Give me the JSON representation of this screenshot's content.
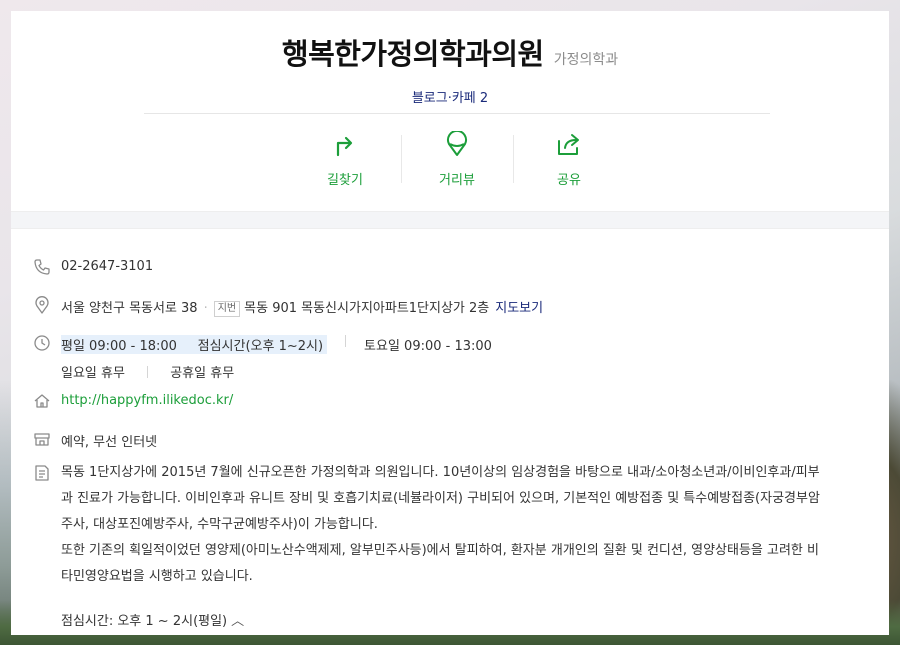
{
  "header": {
    "title": "행복한가정의학과의원",
    "category": "가정의학과",
    "blog_cafe": "블로그·카페 2"
  },
  "actions": [
    {
      "label": "길찾기",
      "icon": "directions-icon"
    },
    {
      "label": "거리뷰",
      "icon": "street-view-icon"
    },
    {
      "label": "공유",
      "icon": "share-icon"
    }
  ],
  "info": {
    "phone": "02-2647-3101",
    "address": {
      "road": "서울 양천구 목동서로 38",
      "lot_badge": "지번",
      "lot": "목동 901 목동신시가지아파트1단지상가 2층",
      "map_link": "지도보기"
    },
    "hours": {
      "weekday": "평일 09:00 - 18:00",
      "lunch": "점심시간(오후 1~2시)",
      "saturday": "토요일 09:00 - 13:00",
      "sunday": "일요일 휴무",
      "holiday": "공휴일 휴무"
    },
    "website": "http://happyfm.ilikedoc.kr/",
    "amenities": "예약, 무선 인터넷",
    "description_lines": [
      "목동 1단지상가에 2015년 7월에 신규오픈한 가정의학과 의원입니다. 10년이상의 임상경험을 바탕으로 내과/소아청소년과/이비인후과/피부",
      "과 진료가 가능합니다. 이비인후과 유니트 장비 및 호흡기치료(네뷸라이저) 구비되어 있으며, 기본적인 예방접종 및 특수예방접종(자궁경부암",
      "주사, 대상포진예방주사, 수막구균예방주사)이 가능합니다.",
      "또한 기존의 획일적이었던 영양제(아미노산수액제제, 알부민주사등)에서 탈피하여, 환자분 개개인의 질환 및 컨디션, 영양상태등을 고려한 비",
      "타민영양요법을 시행하고 있습니다."
    ],
    "lunch_toggle": "점심시간: 오후 1 ~ 2시(평일)",
    "lunch_toggle_icon": "chevron-up-icon"
  },
  "colors": {
    "accent_green": "#1c9e3a",
    "link_navy": "#1a2a7a"
  }
}
